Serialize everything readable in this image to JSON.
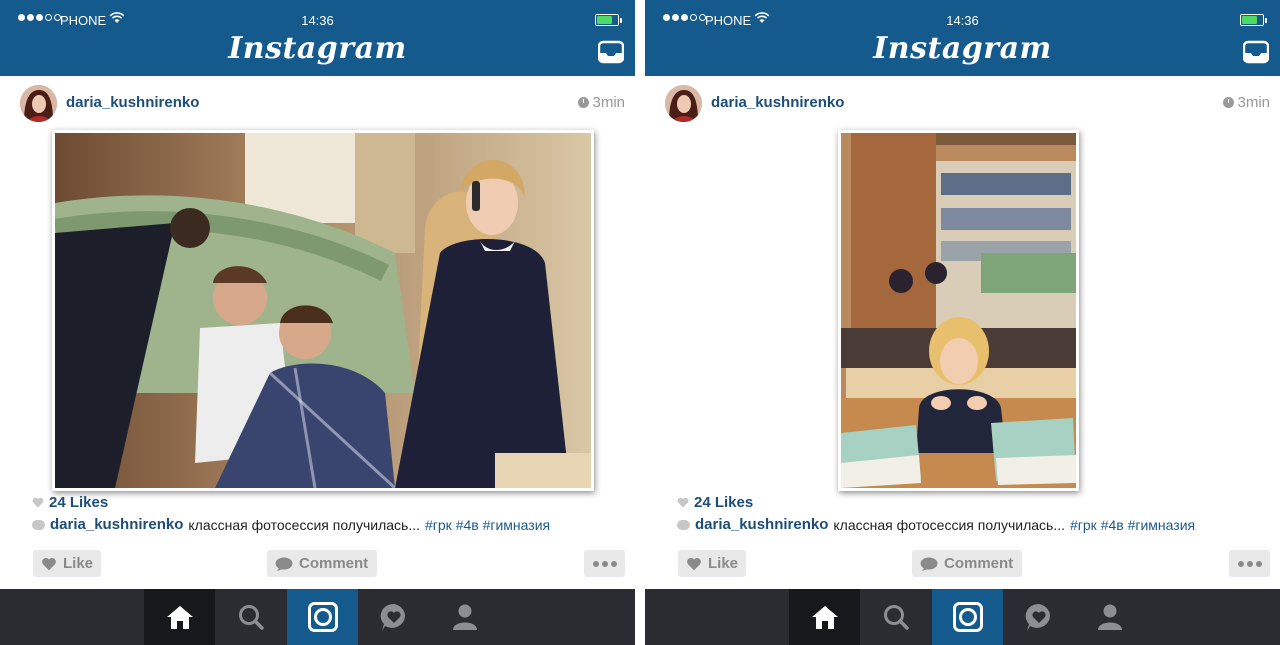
{
  "colors": {
    "header": "#155a8c",
    "link": "#1d4e7a",
    "tabbar": "#2b2c31",
    "tab_active": "#155a8c"
  },
  "screens": [
    {
      "status": {
        "carrier": "PHONE",
        "time": "14:36"
      },
      "app_title": "Instagram",
      "post": {
        "username": "daria_kushnirenko",
        "time_ago": "3min",
        "photo": "photo: girl on phone leaning against a wall beside boys playing on tablets",
        "likes": "24 Likes",
        "caption": {
          "author": "daria_kushnirenko",
          "text": "классная фотосессия получилась...",
          "tags": "#грк #4в #гимназия"
        }
      },
      "actions": {
        "like": "Like",
        "comment": "Comment"
      },
      "tabs": [
        "home-icon",
        "search-icon",
        "camera-icon",
        "activity-icon",
        "profile-icon"
      ]
    },
    {
      "status": {
        "carrier": "PHONE",
        "time": "14:36"
      },
      "app_title": "Instagram",
      "post": {
        "username": "daria_kushnirenko",
        "time_ago": "3min",
        "photo": "photo: smiling girl at a classroom desk with stacks of notebooks",
        "likes": "24 Likes",
        "caption": {
          "author": "daria_kushnirenko",
          "text": "классная фотосессия получилась...",
          "tags": "#грк #4в #гимназия"
        }
      },
      "actions": {
        "like": "Like",
        "comment": "Comment"
      },
      "tabs": [
        "home-icon",
        "search-icon",
        "camera-icon",
        "activity-icon",
        "profile-icon"
      ]
    }
  ]
}
